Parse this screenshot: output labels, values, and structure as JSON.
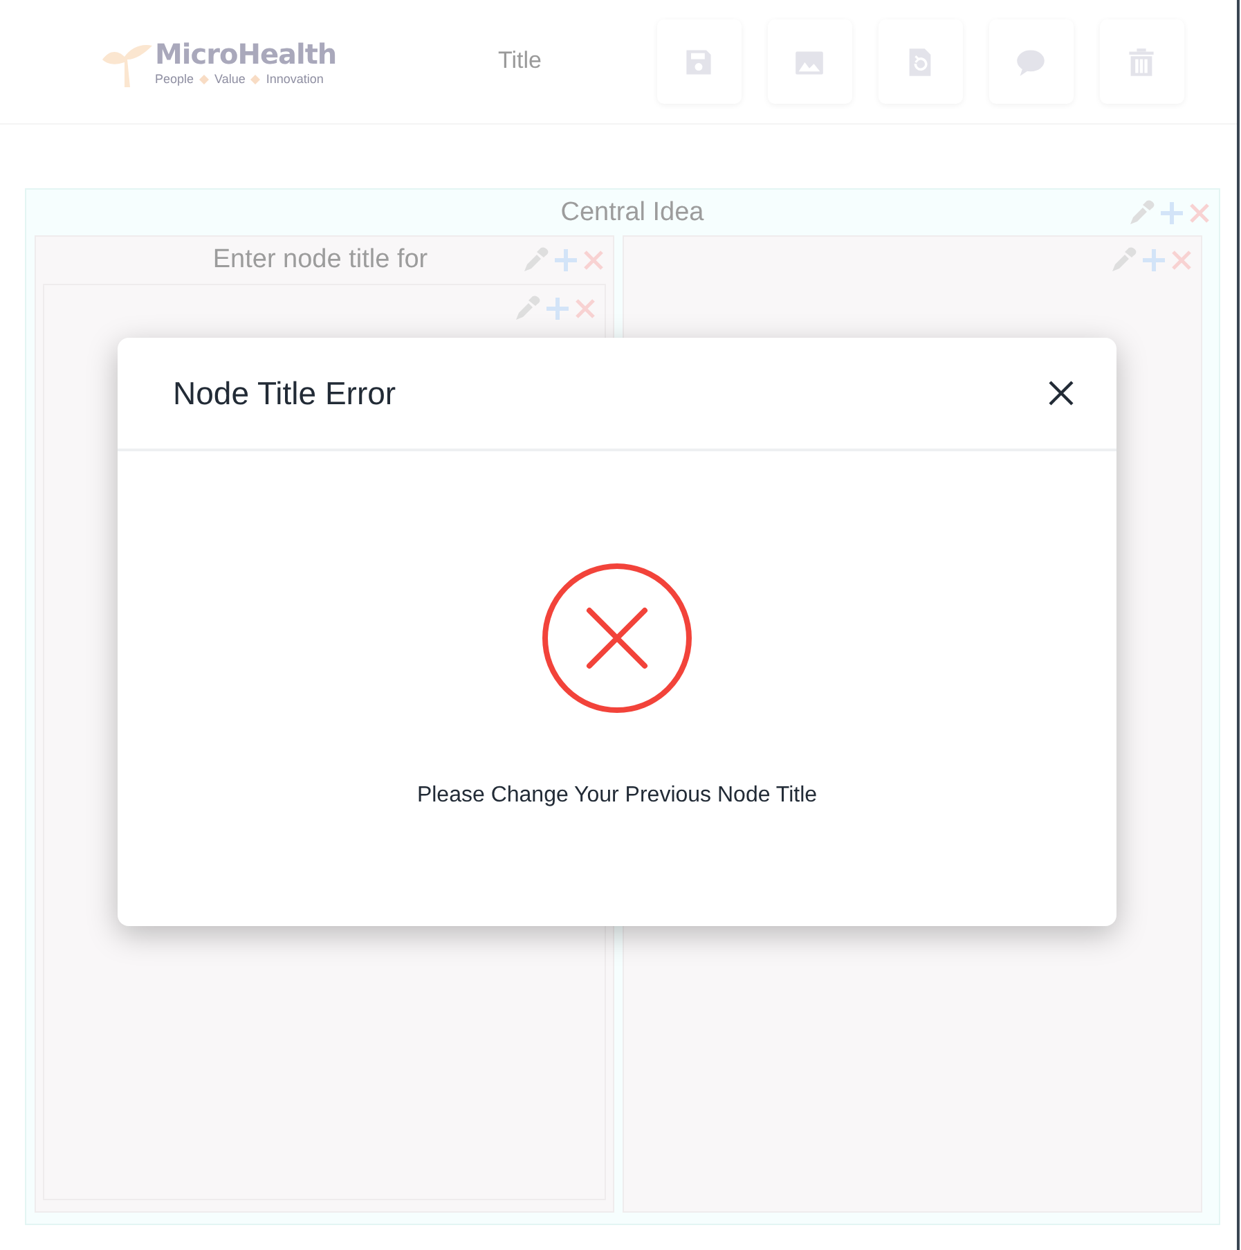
{
  "header": {
    "logo": {
      "name": "MicroHealth",
      "tagline": [
        "People",
        "Value",
        "Innovation"
      ]
    },
    "title": "Title",
    "toolbar": [
      {
        "kind": "save"
      },
      {
        "kind": "image"
      },
      {
        "kind": "restore"
      },
      {
        "kind": "comment"
      },
      {
        "kind": "delete"
      }
    ]
  },
  "mindmap": {
    "kind": "node",
    "title": "Central Idea",
    "children": [
      {
        "kind": "node",
        "title": "Enter node title for",
        "children": [
          {
            "kind": "node"
          }
        ]
      },
      {
        "kind": "node"
      }
    ]
  },
  "dialog": {
    "kind": "error",
    "title": "Node Title Error",
    "message": "Please Change Your Previous Node Title"
  }
}
